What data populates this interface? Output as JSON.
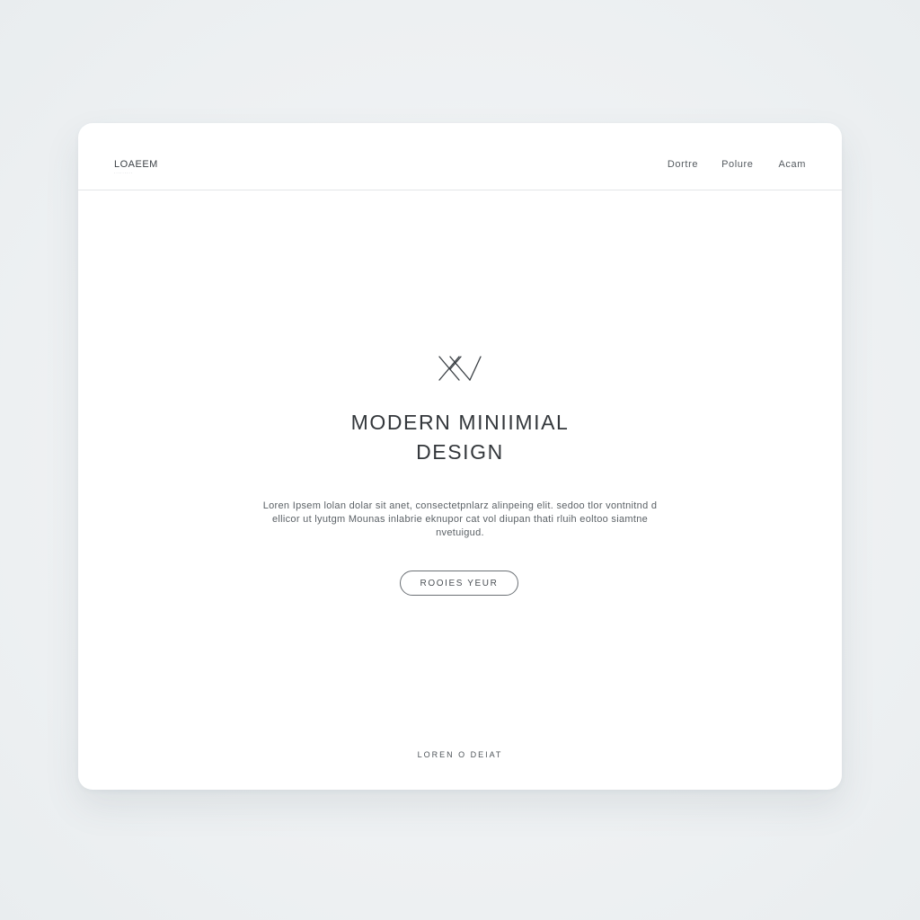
{
  "header": {
    "logo": "LOAEEM",
    "logo_tagline": "·········",
    "nav": [
      {
        "label": "Dortre"
      },
      {
        "label": "Polure"
      },
      {
        "label": "Acam"
      }
    ]
  },
  "hero": {
    "icon": "crossed-lines-logo-icon",
    "title_line1": "MODERN MINIIMIAL",
    "title_line2": "DESIGN",
    "body": "Loren Ipsem lolan dolar sit anet, consectetpnlarz alinpeing elit. sedoo tlor vontnitnd d ellicor ut lyutgm Mounas inlabrie eknupor cat vol diupan thati rluih eoltoo siamtne nvetuigud.",
    "cta_label": "ROOIES YEUR"
  },
  "footer": {
    "text": "LOREN O DEIAT"
  },
  "colors": {
    "background": "#eef1f3",
    "card": "#ffffff",
    "text": "#33373b",
    "divider": "#e3e5e7"
  }
}
